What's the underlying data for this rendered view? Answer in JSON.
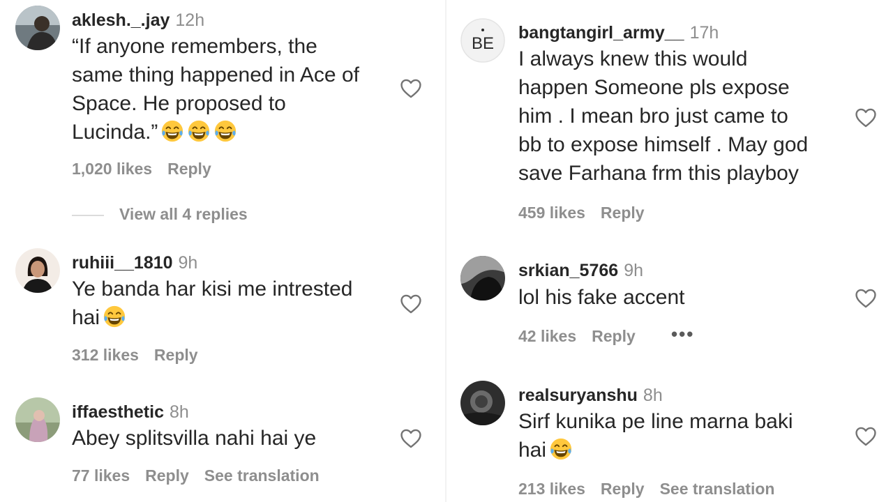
{
  "left": [
    {
      "username": "aklesh._.jay",
      "time": "12h",
      "text": "“If anyone remembers, the\nsame thing happened in Ace of\nSpace. He proposed to\nLucinda.”",
      "emojis": 3,
      "likes": "1,020 likes",
      "reply": "Reply",
      "view_replies": "View all 4 replies"
    },
    {
      "username": "ruhiii__1810",
      "time": "9h",
      "text": "Ye banda har kisi me intrested\nhai",
      "emojis": 1,
      "likes": "312 likes",
      "reply": "Reply"
    },
    {
      "username": "iffaesthetic",
      "time": "8h",
      "text": "Abey splitsvilla nahi hai ye",
      "emojis": 0,
      "likes": "77 likes",
      "reply": "Reply",
      "translation": "See translation"
    }
  ],
  "right": [
    {
      "username": "bangtangirl_army__",
      "time": "17h",
      "avatar_text": "BE",
      "text": "I always knew this would\nhappen Someone pls expose\nhim . I mean bro just came to\nbb to expose himself . May god\nsave Farhana frm this playboy",
      "emojis": 0,
      "likes": "459 likes",
      "reply": "Reply"
    },
    {
      "username": "srkian_5766",
      "time": "9h",
      "text": "lol his fake accent",
      "emojis": 0,
      "likes": "42 likes",
      "reply": "Reply",
      "more": "•••"
    },
    {
      "username": "realsuryanshu",
      "time": "8h",
      "text": "Sirf kunika pe line marna baki\nhai",
      "emojis": 1,
      "likes": "213 likes",
      "reply": "Reply",
      "translation": "See translation"
    }
  ],
  "icons": {
    "heart": "heart-outline-icon",
    "emoji": "laughing-tears-emoji",
    "more": "more-options-icon"
  },
  "colors": {
    "muted": "#8e8e8e",
    "text": "#262626",
    "emoji_face": "#ffc83d"
  }
}
